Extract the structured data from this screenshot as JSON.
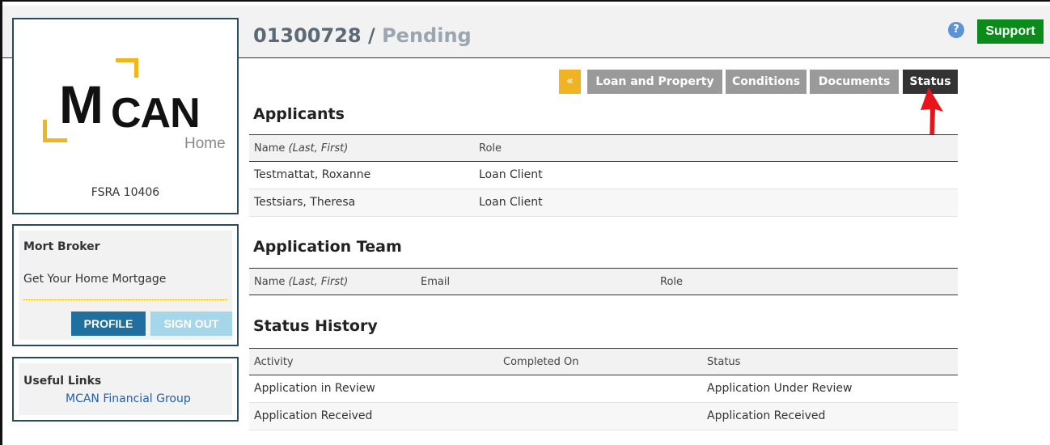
{
  "header": {
    "loan_number": "01300728",
    "separator": " / ",
    "status": "Pending",
    "help_glyph": "?",
    "support_label": "Support"
  },
  "sidebar": {
    "logo": {
      "m": "M",
      "can": "CAN",
      "home": "Home"
    },
    "fsra": "FSRA 10406",
    "broker": {
      "name": "Mort Broker",
      "tagline": "Get Your Home Mortgage",
      "profile_label": "PROFILE",
      "signout_label": "SIGN OUT"
    },
    "links": {
      "title": "Useful Links",
      "items": [
        "MCAN Financial Group"
      ]
    }
  },
  "tabs": {
    "back": "«",
    "items": [
      "Loan and Property",
      "Conditions",
      "Documents",
      "Status"
    ],
    "active": "Status"
  },
  "applicants": {
    "title": "Applicants",
    "columns": {
      "name": "Name",
      "name_hint": "(Last, First)",
      "role": "Role"
    },
    "rows": [
      {
        "name": "Testmattat, Roxanne",
        "role": "Loan Client"
      },
      {
        "name": "Testsiars, Theresa",
        "role": "Loan Client"
      }
    ]
  },
  "team": {
    "title": "Application Team",
    "columns": {
      "name": "Name",
      "name_hint": "(Last, First)",
      "email": "Email",
      "role": "Role"
    }
  },
  "history": {
    "title": "Status History",
    "columns": {
      "activity": "Activity",
      "completed": "Completed On",
      "status": "Status"
    },
    "rows": [
      {
        "activity": "Application in Review",
        "completed": "",
        "status": "Application Under Review"
      },
      {
        "activity": "Application Received",
        "completed": "",
        "status": "Application Received"
      }
    ]
  },
  "colors": {
    "accent_yellow": "#f0b323",
    "profile_blue": "#1f6f9f",
    "support_green": "#0d8a1c",
    "arrow_red": "#e8141b"
  },
  "icons": [
    "help-icon",
    "red-arrow-annotation"
  ]
}
